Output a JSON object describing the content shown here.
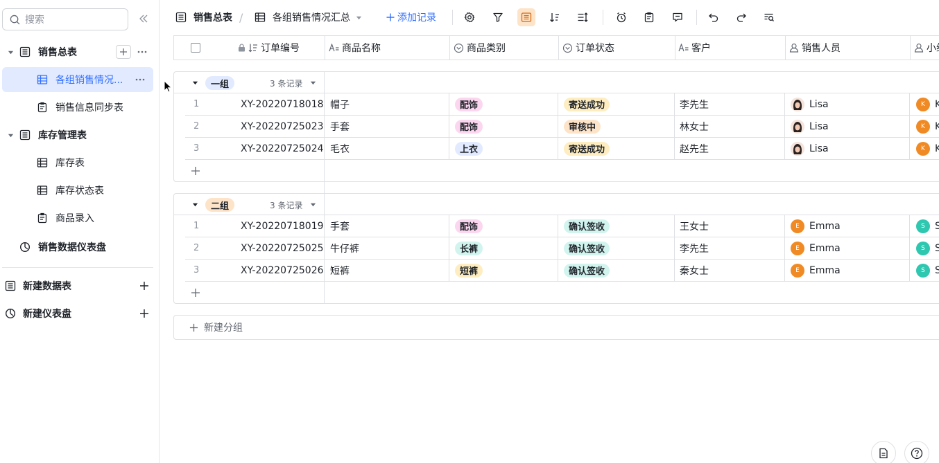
{
  "sidebar": {
    "search_placeholder": "搜索",
    "items": [
      {
        "label": "销售总表",
        "icon": "table-icon",
        "level": 0,
        "expanded": true
      },
      {
        "label": "各组销售情况...",
        "icon": "grid-view-icon",
        "level": 1,
        "active": true
      },
      {
        "label": "销售信息同步表",
        "icon": "form-icon",
        "level": 1
      },
      {
        "label": "库存管理表",
        "icon": "table-icon",
        "level": 0,
        "expanded": true
      },
      {
        "label": "库存表",
        "icon": "grid-view-icon",
        "level": 1
      },
      {
        "label": "库存状态表",
        "icon": "grid-view-icon",
        "level": 1
      },
      {
        "label": "商品录入",
        "icon": "form-icon",
        "level": 1
      },
      {
        "label": "销售数据仪表盘",
        "icon": "dashboard-icon",
        "level": 0
      }
    ],
    "new_table_label": "新建数据表",
    "new_dashboard_label": "新建仪表盘"
  },
  "toolbar": {
    "table_name": "销售总表",
    "view_name": "各组销售情况汇总",
    "add_record_label": "添加记录"
  },
  "columns": [
    {
      "label": "订单编号",
      "icon": "sort-lock-icon"
    },
    {
      "label": "商品名称",
      "icon": "text-type-icon"
    },
    {
      "label": "商品类别",
      "icon": "single-select-icon"
    },
    {
      "label": "订单状态",
      "icon": "single-select-icon"
    },
    {
      "label": "客户",
      "icon": "text-type-icon"
    },
    {
      "label": "销售人员",
      "icon": "person-icon"
    },
    {
      "label": "小组",
      "icon": "person-icon"
    }
  ],
  "groups": [
    {
      "name": "一组",
      "count_label": "3 条记录",
      "tag_bg": "#e1eaff",
      "rows": [
        {
          "idx": "1",
          "order": "XY-20220718018",
          "product": "帽子",
          "category": "配饰",
          "status": "寄送成功",
          "customer": "李先生",
          "sales": "Lisa",
          "team": "K"
        },
        {
          "idx": "2",
          "order": "XY-20220725023",
          "product": "手套",
          "category": "配饰",
          "status": "审核中",
          "customer": "林女士",
          "sales": "Lisa",
          "team": "K"
        },
        {
          "idx": "3",
          "order": "XY-20220725024",
          "product": "毛衣",
          "category": "上衣",
          "status": "寄送成功",
          "customer": "赵先生",
          "sales": "Lisa",
          "team": "K"
        }
      ]
    },
    {
      "name": "二组",
      "count_label": "3 条记录",
      "tag_bg": "#fde3c8",
      "rows": [
        {
          "idx": "1",
          "order": "XY-20220718019",
          "product": "手套",
          "category": "配饰",
          "status": "确认签收",
          "customer": "王女士",
          "sales": "Emma",
          "team": "S"
        },
        {
          "idx": "2",
          "order": "XY-20220725025",
          "product": "牛仔裤",
          "category": "长裤",
          "status": "确认签收",
          "customer": "李先生",
          "sales": "Emma",
          "team": "S"
        },
        {
          "idx": "3",
          "order": "XY-20220725026",
          "product": "短裤",
          "category": "短裤",
          "status": "确认签收",
          "customer": "秦女士",
          "sales": "Emma",
          "team": "S"
        }
      ]
    }
  ],
  "new_group_label": "新建分组",
  "avatar_initials": {
    "sales": "E",
    "team_g1": "K",
    "team_g2": "S"
  },
  "colors": {
    "accent": "#3370ff",
    "tag_peishi": "#fcd6ee",
    "tag_shangyi": "#e1eaff",
    "tag_changku": "#d1f4ef",
    "tag_duanku": "#fdedc0",
    "status_sent": "#fdedc0",
    "status_review": "#fde3c8",
    "status_confirm": "#d1f4ef",
    "avatar_orange": "#f08a24",
    "avatar_teal": "#2ec7b0"
  }
}
